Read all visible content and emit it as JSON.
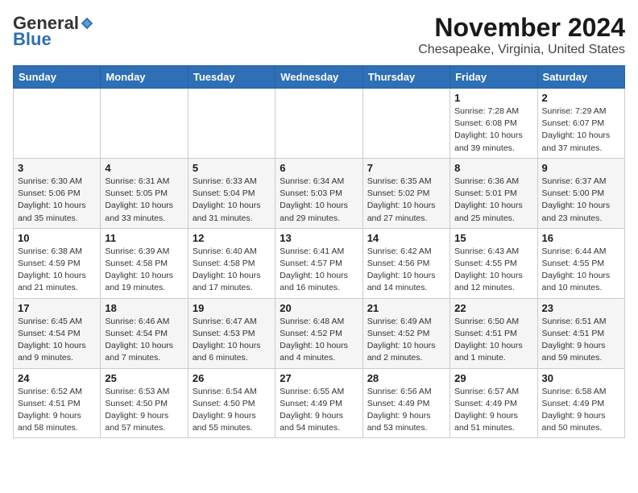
{
  "header": {
    "logo_general": "General",
    "logo_blue": "Blue",
    "month_title": "November 2024",
    "location": "Chesapeake, Virginia, United States"
  },
  "weekdays": [
    "Sunday",
    "Monday",
    "Tuesday",
    "Wednesday",
    "Thursday",
    "Friday",
    "Saturday"
  ],
  "weeks": [
    [
      {
        "day": "",
        "info": ""
      },
      {
        "day": "",
        "info": ""
      },
      {
        "day": "",
        "info": ""
      },
      {
        "day": "",
        "info": ""
      },
      {
        "day": "",
        "info": ""
      },
      {
        "day": "1",
        "info": "Sunrise: 7:28 AM\nSunset: 6:08 PM\nDaylight: 10 hours\nand 39 minutes."
      },
      {
        "day": "2",
        "info": "Sunrise: 7:29 AM\nSunset: 6:07 PM\nDaylight: 10 hours\nand 37 minutes."
      }
    ],
    [
      {
        "day": "3",
        "info": "Sunrise: 6:30 AM\nSunset: 5:06 PM\nDaylight: 10 hours\nand 35 minutes."
      },
      {
        "day": "4",
        "info": "Sunrise: 6:31 AM\nSunset: 5:05 PM\nDaylight: 10 hours\nand 33 minutes."
      },
      {
        "day": "5",
        "info": "Sunrise: 6:33 AM\nSunset: 5:04 PM\nDaylight: 10 hours\nand 31 minutes."
      },
      {
        "day": "6",
        "info": "Sunrise: 6:34 AM\nSunset: 5:03 PM\nDaylight: 10 hours\nand 29 minutes."
      },
      {
        "day": "7",
        "info": "Sunrise: 6:35 AM\nSunset: 5:02 PM\nDaylight: 10 hours\nand 27 minutes."
      },
      {
        "day": "8",
        "info": "Sunrise: 6:36 AM\nSunset: 5:01 PM\nDaylight: 10 hours\nand 25 minutes."
      },
      {
        "day": "9",
        "info": "Sunrise: 6:37 AM\nSunset: 5:00 PM\nDaylight: 10 hours\nand 23 minutes."
      }
    ],
    [
      {
        "day": "10",
        "info": "Sunrise: 6:38 AM\nSunset: 4:59 PM\nDaylight: 10 hours\nand 21 minutes."
      },
      {
        "day": "11",
        "info": "Sunrise: 6:39 AM\nSunset: 4:58 PM\nDaylight: 10 hours\nand 19 minutes."
      },
      {
        "day": "12",
        "info": "Sunrise: 6:40 AM\nSunset: 4:58 PM\nDaylight: 10 hours\nand 17 minutes."
      },
      {
        "day": "13",
        "info": "Sunrise: 6:41 AM\nSunset: 4:57 PM\nDaylight: 10 hours\nand 16 minutes."
      },
      {
        "day": "14",
        "info": "Sunrise: 6:42 AM\nSunset: 4:56 PM\nDaylight: 10 hours\nand 14 minutes."
      },
      {
        "day": "15",
        "info": "Sunrise: 6:43 AM\nSunset: 4:55 PM\nDaylight: 10 hours\nand 12 minutes."
      },
      {
        "day": "16",
        "info": "Sunrise: 6:44 AM\nSunset: 4:55 PM\nDaylight: 10 hours\nand 10 minutes."
      }
    ],
    [
      {
        "day": "17",
        "info": "Sunrise: 6:45 AM\nSunset: 4:54 PM\nDaylight: 10 hours\nand 9 minutes."
      },
      {
        "day": "18",
        "info": "Sunrise: 6:46 AM\nSunset: 4:54 PM\nDaylight: 10 hours\nand 7 minutes."
      },
      {
        "day": "19",
        "info": "Sunrise: 6:47 AM\nSunset: 4:53 PM\nDaylight: 10 hours\nand 6 minutes."
      },
      {
        "day": "20",
        "info": "Sunrise: 6:48 AM\nSunset: 4:52 PM\nDaylight: 10 hours\nand 4 minutes."
      },
      {
        "day": "21",
        "info": "Sunrise: 6:49 AM\nSunset: 4:52 PM\nDaylight: 10 hours\nand 2 minutes."
      },
      {
        "day": "22",
        "info": "Sunrise: 6:50 AM\nSunset: 4:51 PM\nDaylight: 10 hours\nand 1 minute."
      },
      {
        "day": "23",
        "info": "Sunrise: 6:51 AM\nSunset: 4:51 PM\nDaylight: 9 hours\nand 59 minutes."
      }
    ],
    [
      {
        "day": "24",
        "info": "Sunrise: 6:52 AM\nSunset: 4:51 PM\nDaylight: 9 hours\nand 58 minutes."
      },
      {
        "day": "25",
        "info": "Sunrise: 6:53 AM\nSunset: 4:50 PM\nDaylight: 9 hours\nand 57 minutes."
      },
      {
        "day": "26",
        "info": "Sunrise: 6:54 AM\nSunset: 4:50 PM\nDaylight: 9 hours\nand 55 minutes."
      },
      {
        "day": "27",
        "info": "Sunrise: 6:55 AM\nSunset: 4:49 PM\nDaylight: 9 hours\nand 54 minutes."
      },
      {
        "day": "28",
        "info": "Sunrise: 6:56 AM\nSunset: 4:49 PM\nDaylight: 9 hours\nand 53 minutes."
      },
      {
        "day": "29",
        "info": "Sunrise: 6:57 AM\nSunset: 4:49 PM\nDaylight: 9 hours\nand 51 minutes."
      },
      {
        "day": "30",
        "info": "Sunrise: 6:58 AM\nSunset: 4:49 PM\nDaylight: 9 hours\nand 50 minutes."
      }
    ]
  ]
}
